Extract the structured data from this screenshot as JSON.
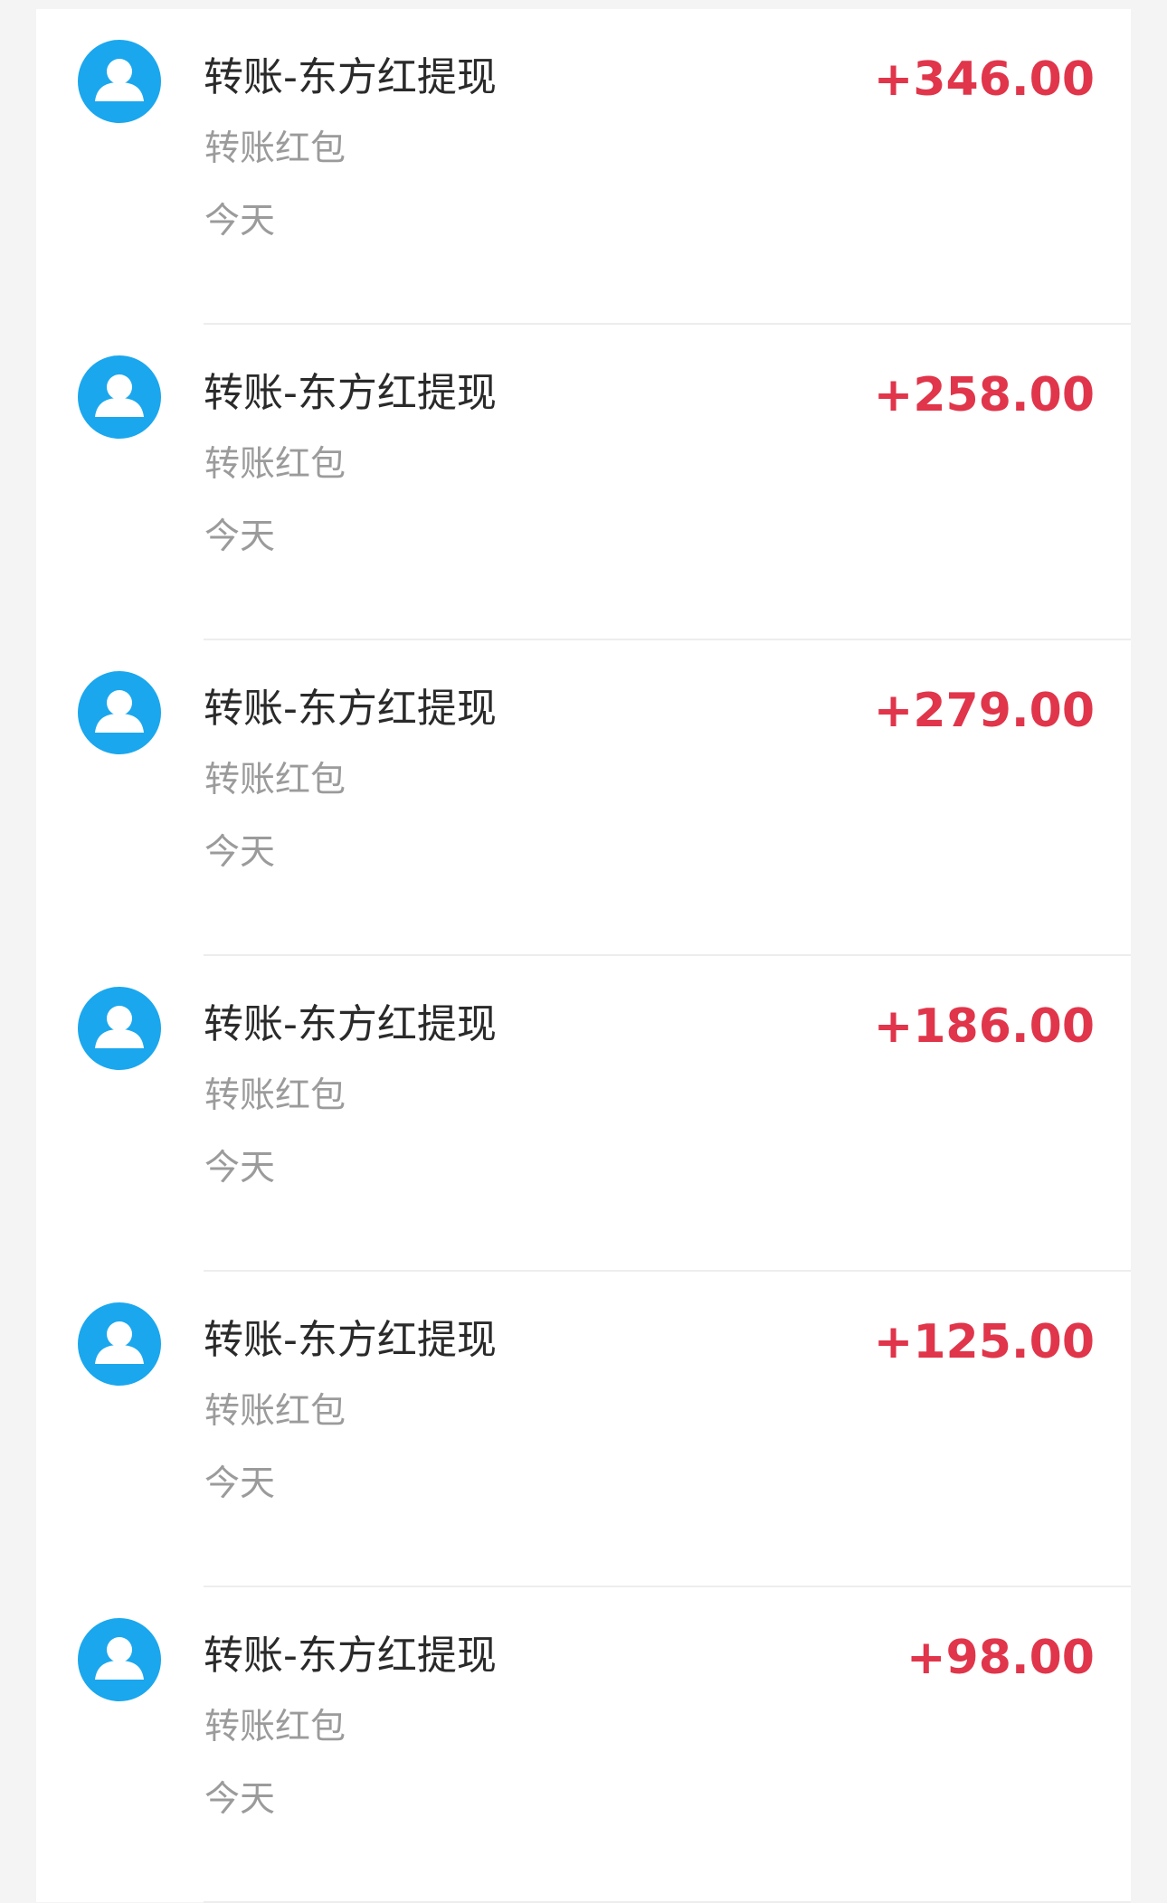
{
  "colors": {
    "page_background": "#f4f4f4",
    "card_background": "#ffffff",
    "avatar_blue": "#1aa7ee",
    "amount_red": "#e0354a",
    "title_text": "#2a2a2a",
    "secondary_text": "#9b9b9b",
    "divider": "#ededed"
  },
  "transactions": [
    {
      "title": "转账-东方红提现",
      "subtitle": "转账红包",
      "date": "今天",
      "amount": "+346.00",
      "avatar_icon": "user-avatar-icon"
    },
    {
      "title": "转账-东方红提现",
      "subtitle": "转账红包",
      "date": "今天",
      "amount": "+258.00",
      "avatar_icon": "user-avatar-icon"
    },
    {
      "title": "转账-东方红提现",
      "subtitle": "转账红包",
      "date": "今天",
      "amount": "+279.00",
      "avatar_icon": "user-avatar-icon"
    },
    {
      "title": "转账-东方红提现",
      "subtitle": "转账红包",
      "date": "今天",
      "amount": "+186.00",
      "avatar_icon": "user-avatar-icon"
    },
    {
      "title": "转账-东方红提现",
      "subtitle": "转账红包",
      "date": "今天",
      "amount": "+125.00",
      "avatar_icon": "user-avatar-icon"
    },
    {
      "title": "转账-东方红提现",
      "subtitle": "转账红包",
      "date": "今天",
      "amount": "+98.00",
      "avatar_icon": "user-avatar-icon"
    }
  ]
}
